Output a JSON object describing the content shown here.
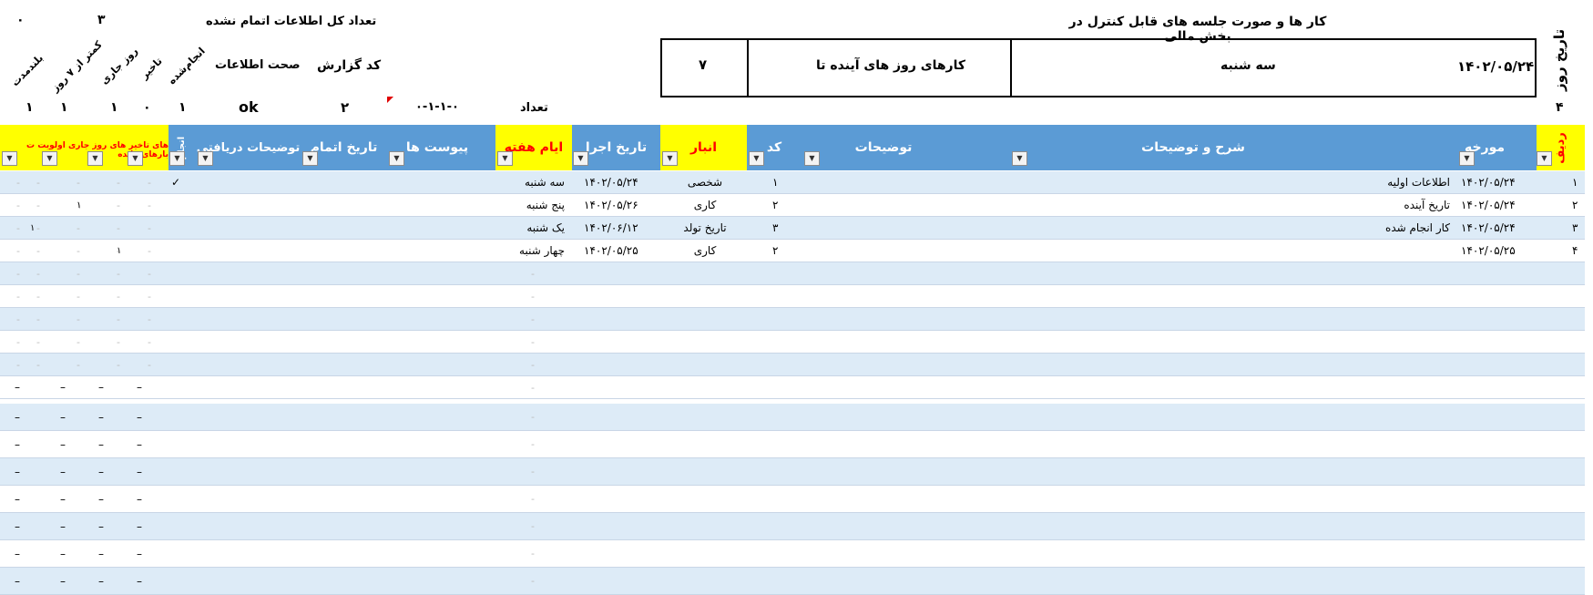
{
  "header": {
    "title": "کار ها و صورت جلسه های قابل کنترل در بخش مالی",
    "date_label": "تاریخ روز",
    "date_value": "۱۴۰۲/۰۵/۲۴",
    "weekday": "سه شنبه",
    "upcoming_label": "کارهای روز های آینده تا",
    "upcoming_value": "۷",
    "total_incomplete_label": "تعداد کل اطلاعات اتمام نشده",
    "total_incomplete_value": "۳",
    "zero_value": "۰",
    "report_code_label": "کد گزارش",
    "data_integrity_label": "صحت اطلاعات",
    "count_label": "تعداد",
    "code_value": "۰-۱-۱-۰",
    "report_code_value": "۲",
    "ok_value": "ok",
    "row_count": "۴"
  },
  "stat_columns": [
    {
      "label": "انجام‌شده",
      "value": "۱"
    },
    {
      "label": "تاخیر",
      "value": "۰"
    },
    {
      "label": "روز جاری",
      "value": "۱"
    },
    {
      "label": "کمتر از ۷ روز",
      "value": "۱"
    },
    {
      "label": "بلندمدت",
      "value": "۱"
    }
  ],
  "columns": {
    "row": "ردیف",
    "date": "مورخه",
    "desc_title": "شرح و توضیحات",
    "notes": "توضیحات",
    "code": "کد",
    "warehouse": "انبار",
    "exec_date": "تاریخ اجرا",
    "weekday": "ایام هفته",
    "attachments": "پیوست ها",
    "finish_date": "تاریخ اتمام",
    "received_notes": "توضیحات دریافتی",
    "done_mark": "انجام",
    "remaining": "های تاخیر های روز جاری اولویت ت بارهای مانده"
  },
  "rows": [
    {
      "num": "۱",
      "date": "۱۴۰۲/۰۵/۲۴",
      "desc": "اطلاعات اولیه",
      "code": "۱",
      "warehouse": "شخصی",
      "exec": "۱۴۰۲/۰۵/۲۴",
      "weekday": "سه شنبه",
      "check": "✓",
      "flag": ""
    },
    {
      "num": "۲",
      "date": "۱۴۰۲/۰۵/۲۴",
      "desc": "تاریخ آینده",
      "code": "۲",
      "warehouse": "کاری",
      "exec": "۱۴۰۲/۰۵/۲۶",
      "weekday": "پنج شنبه",
      "check": "",
      "flag": "۱"
    },
    {
      "num": "۳",
      "date": "۱۴۰۲/۰۵/۲۴",
      "desc": "کار انجام شده",
      "code": "۳",
      "warehouse": "تاریخ تولد",
      "exec": "۱۴۰۲/۰۶/۱۲",
      "weekday": "یک شنبه",
      "check": "",
      "flag": "۱"
    },
    {
      "num": "۴",
      "date": "۱۴۰۲/۰۵/۲۵",
      "desc": "",
      "code": "۲",
      "warehouse": "کاری",
      "exec": "۱۴۰۲/۰۵/۲۵",
      "weekday": "چهار شنبه",
      "check": "",
      "flag": "۱"
    }
  ],
  "dash": "-",
  "long_dash": "–",
  "colors": {
    "header_blue": "#5b9bd5",
    "row_blue": "#ddebf7",
    "highlight_yellow": "#ffff00",
    "highlight_red": "#ff0000"
  }
}
